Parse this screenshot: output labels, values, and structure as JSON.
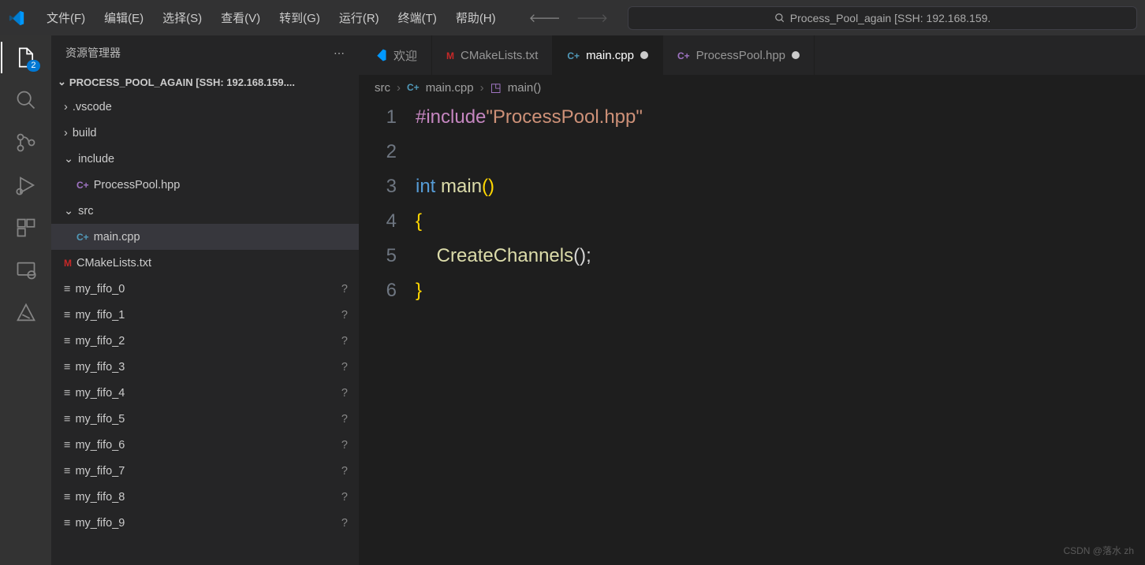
{
  "menu": {
    "file": "文件(F)",
    "edit": "编辑(E)",
    "select": "选择(S)",
    "view": "查看(V)",
    "goto": "转到(G)",
    "run": "运行(R)",
    "terminal": "终端(T)",
    "help": "帮助(H)"
  },
  "search_placeholder": "Process_Pool_again [SSH: 192.168.159.",
  "explorer_badge": "2",
  "sidebar": {
    "title": "资源管理器",
    "project": "PROCESS_POOL_AGAIN [SSH: 192.168.159....",
    "tree": [
      {
        "name": ".vscode",
        "type": "folder",
        "open": false,
        "indent": 1
      },
      {
        "name": "build",
        "type": "folder",
        "open": false,
        "indent": 1
      },
      {
        "name": "include",
        "type": "folder",
        "open": true,
        "indent": 1
      },
      {
        "name": "ProcessPool.hpp",
        "type": "hpp",
        "indent": 2
      },
      {
        "name": "src",
        "type": "folder",
        "open": true,
        "indent": 1
      },
      {
        "name": "main.cpp",
        "type": "cpp",
        "indent": 2,
        "selected": true
      },
      {
        "name": "CMakeLists.txt",
        "type": "cmake",
        "indent": 1
      },
      {
        "name": "my_fifo_0",
        "type": "file",
        "indent": 1,
        "status": "?"
      },
      {
        "name": "my_fifo_1",
        "type": "file",
        "indent": 1,
        "status": "?"
      },
      {
        "name": "my_fifo_2",
        "type": "file",
        "indent": 1,
        "status": "?"
      },
      {
        "name": "my_fifo_3",
        "type": "file",
        "indent": 1,
        "status": "?"
      },
      {
        "name": "my_fifo_4",
        "type": "file",
        "indent": 1,
        "status": "?"
      },
      {
        "name": "my_fifo_5",
        "type": "file",
        "indent": 1,
        "status": "?"
      },
      {
        "name": "my_fifo_6",
        "type": "file",
        "indent": 1,
        "status": "?"
      },
      {
        "name": "my_fifo_7",
        "type": "file",
        "indent": 1,
        "status": "?"
      },
      {
        "name": "my_fifo_8",
        "type": "file",
        "indent": 1,
        "status": "?"
      },
      {
        "name": "my_fifo_9",
        "type": "file",
        "indent": 1,
        "status": "?"
      }
    ]
  },
  "tabs": [
    {
      "icon": "vs",
      "label": "欢迎",
      "active": false
    },
    {
      "icon": "cmake",
      "label": "CMakeLists.txt",
      "active": false
    },
    {
      "icon": "cpp",
      "label": "main.cpp",
      "active": true,
      "dirty": true
    },
    {
      "icon": "hpp",
      "label": "ProcessPool.hpp",
      "active": false,
      "dirty": true
    }
  ],
  "breadcrumb": {
    "p1": "src",
    "p2": "main.cpp",
    "p3": "main()"
  },
  "code": {
    "l1a": "#include",
    "l1b": "\"ProcessPool.hpp\"",
    "l3a": "int",
    "l3b": " main",
    "l3c": "()",
    "l4": "{",
    "l5a": "    CreateChannels",
    "l5b": "();",
    "l6": "}"
  },
  "watermark": "CSDN @落水 zh"
}
